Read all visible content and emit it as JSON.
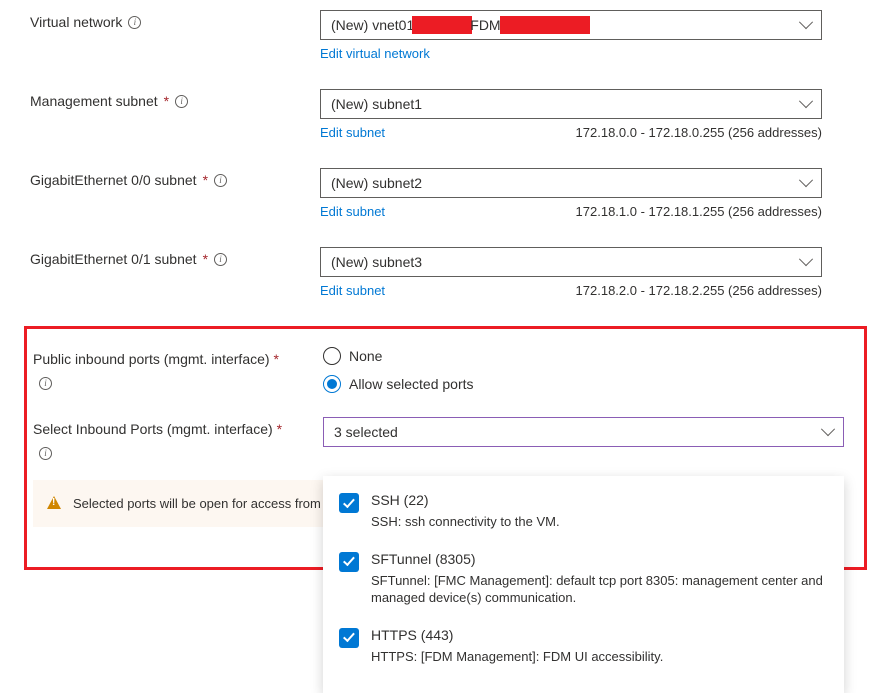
{
  "vnet": {
    "label": "Virtual network",
    "value_prefix": "(New) vnet01",
    "value_mid": "FDM",
    "edit_link": "Edit virtual network"
  },
  "mgmt_subnet": {
    "label": "Management subnet",
    "value": "(New) subnet1",
    "edit_link": "Edit subnet",
    "range": "172.18.0.0 - 172.18.0.255 (256 addresses)"
  },
  "ge00_subnet": {
    "label": "GigabitEthernet 0/0 subnet",
    "value": "(New) subnet2",
    "edit_link": "Edit subnet",
    "range": "172.18.1.0 - 172.18.1.255 (256 addresses)"
  },
  "ge01_subnet": {
    "label": "GigabitEthernet 0/1 subnet",
    "value": "(New) subnet3",
    "edit_link": "Edit subnet",
    "range": "172.18.2.0 - 172.18.2.255 (256 addresses)"
  },
  "public_ports": {
    "label": "Public inbound ports (mgmt. interface)",
    "option_none": "None",
    "option_allow": "Allow selected ports",
    "selected": "allow"
  },
  "select_ports": {
    "label": "Select Inbound Ports (mgmt. interface)",
    "summary": "3 selected",
    "options": [
      {
        "title": "SSH (22)",
        "desc": "SSH: ssh connectivity to the VM.",
        "checked": true
      },
      {
        "title": "SFTunnel (8305)",
        "desc": "SFTunnel: [FMC Management]: default tcp port 8305: management center and managed device(s) communication.",
        "checked": true
      },
      {
        "title": "HTTPS (443)",
        "desc": "HTTPS: [FDM Management]: FDM UI accessibility.",
        "checked": true
      }
    ]
  },
  "warning": "Selected ports will be open for access from the Internet. You can change these settings on the Networking page later."
}
